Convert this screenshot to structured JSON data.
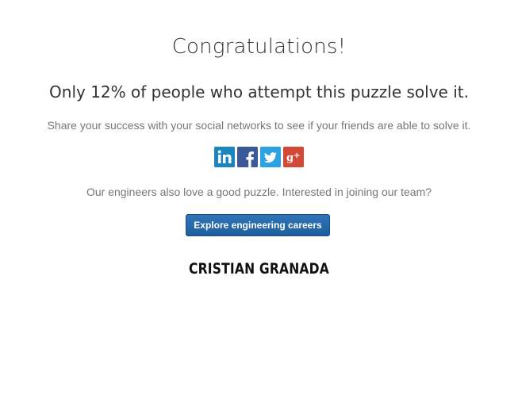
{
  "headline": "Congratulations!",
  "stat_line": "Only 12% of people who attempt this puzzle solve it.",
  "share_text": "Share your success with your social networks to see if your friends are able to solve it.",
  "social": [
    {
      "name": "linkedin",
      "icon": "linkedin-icon",
      "color": "#1a86bd",
      "glyph": "in"
    },
    {
      "name": "facebook",
      "icon": "facebook-icon",
      "color": "#3b5998",
      "glyph": "f"
    },
    {
      "name": "twitter",
      "icon": "twitter-icon",
      "color": "#2aa3e0",
      "glyph": "t"
    },
    {
      "name": "google-plus",
      "icon": "google-plus-icon",
      "color": "#d34836",
      "glyph": "g+"
    }
  ],
  "team_text": "Our engineers also love a good puzzle. Interested in joining our team?",
  "cta_label": "Explore engineering careers",
  "signature": "CRISTIAN GRANADA",
  "colors": {
    "button": "#2467a8",
    "body_text": "#333333",
    "secondary_text": "#777777"
  }
}
